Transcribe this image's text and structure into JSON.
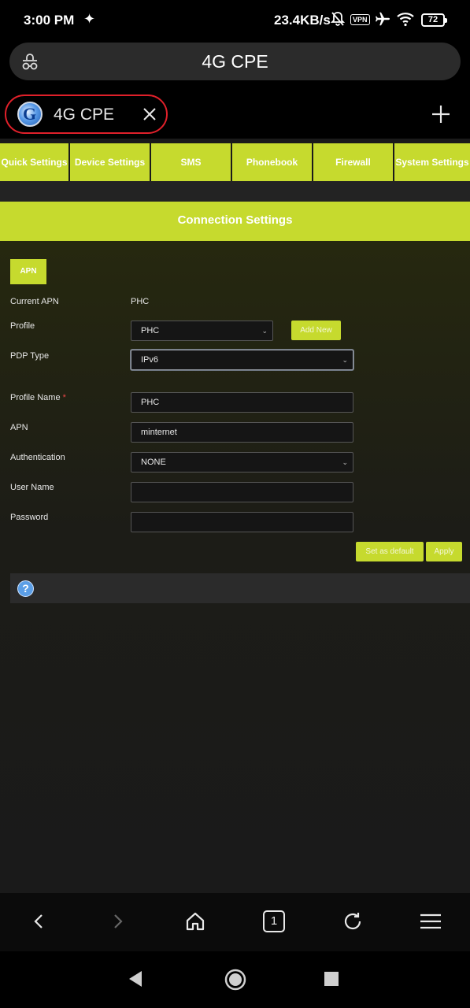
{
  "status_bar": {
    "time": "3:00 PM",
    "speed": "23.4KB/s",
    "vpn_label": "VPN",
    "battery": "72"
  },
  "address_bar": {
    "url_text": "4G CPE",
    "left_icon": "lock-icon"
  },
  "tab": {
    "title": "4G CPE",
    "favicon_letter": "G"
  },
  "nav_menu": [
    {
      "label": "Quick Settings"
    },
    {
      "label": "Device Settings"
    },
    {
      "label": "SMS"
    },
    {
      "label": "Phonebook"
    },
    {
      "label": "Firewall"
    },
    {
      "label": "System Settings"
    }
  ],
  "page": {
    "section_title": "Connection Settings",
    "apn_tab": "APN",
    "current_apn_label": "Current APN",
    "current_apn_value": "PHC",
    "profile_label": "Profile",
    "profile_value": "PHC",
    "add_new": "Add New",
    "pdp_type_label": "PDP Type",
    "pdp_type_value": "IPv6",
    "profile_name_label": "Profile Name",
    "required_mark": "*",
    "profile_name_value": "PHC",
    "apn_label": "APN",
    "apn_value": "minternet",
    "auth_label": "Authentication",
    "auth_value": "NONE",
    "username_label": "User Name",
    "username_value": "",
    "password_label": "Password",
    "password_value": "",
    "set_default": "Set as default",
    "apply": "Apply",
    "help_glyph": "?"
  },
  "colors": {
    "accent": "#c6da2e",
    "tab_highlight": "#e0202a",
    "background": "#1a1a1a"
  }
}
